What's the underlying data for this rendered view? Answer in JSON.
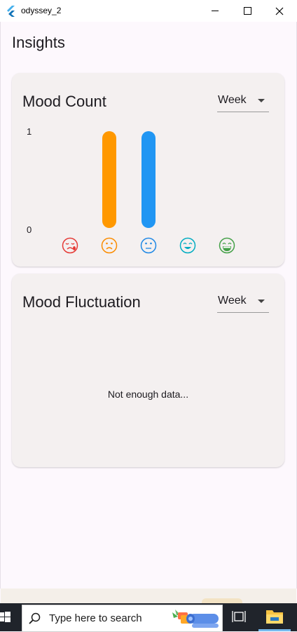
{
  "window": {
    "title": "odyssey_2"
  },
  "page": {
    "title": "Insights"
  },
  "mood_count": {
    "title": "Mood Count",
    "period": "Week",
    "y_max_label": "1",
    "y_min_label": "0",
    "moods": [
      {
        "name": "very-sad",
        "color": "#e53935"
      },
      {
        "name": "sad",
        "color": "#fb8c00"
      },
      {
        "name": "neutral",
        "color": "#1e88e5"
      },
      {
        "name": "happy",
        "color": "#00acc1"
      },
      {
        "name": "very-happy",
        "color": "#43a047"
      }
    ]
  },
  "chart_data": {
    "type": "bar",
    "categories": [
      "very sad",
      "sad",
      "neutral",
      "happy",
      "very happy"
    ],
    "values": [
      0,
      1,
      1,
      0,
      0
    ],
    "colors": [
      "#e53935",
      "#ff9800",
      "#2196f3",
      "#00bcd4",
      "#4caf50"
    ],
    "ylim": [
      0,
      1
    ],
    "y_ticks": [
      0,
      1
    ],
    "grid": false,
    "title": "Mood Count"
  },
  "mood_fluctuation": {
    "title": "Mood Fluctuation",
    "period": "Week",
    "empty_message": "Not enough data..."
  },
  "taskbar": {
    "search_placeholder": "Type here to search"
  }
}
